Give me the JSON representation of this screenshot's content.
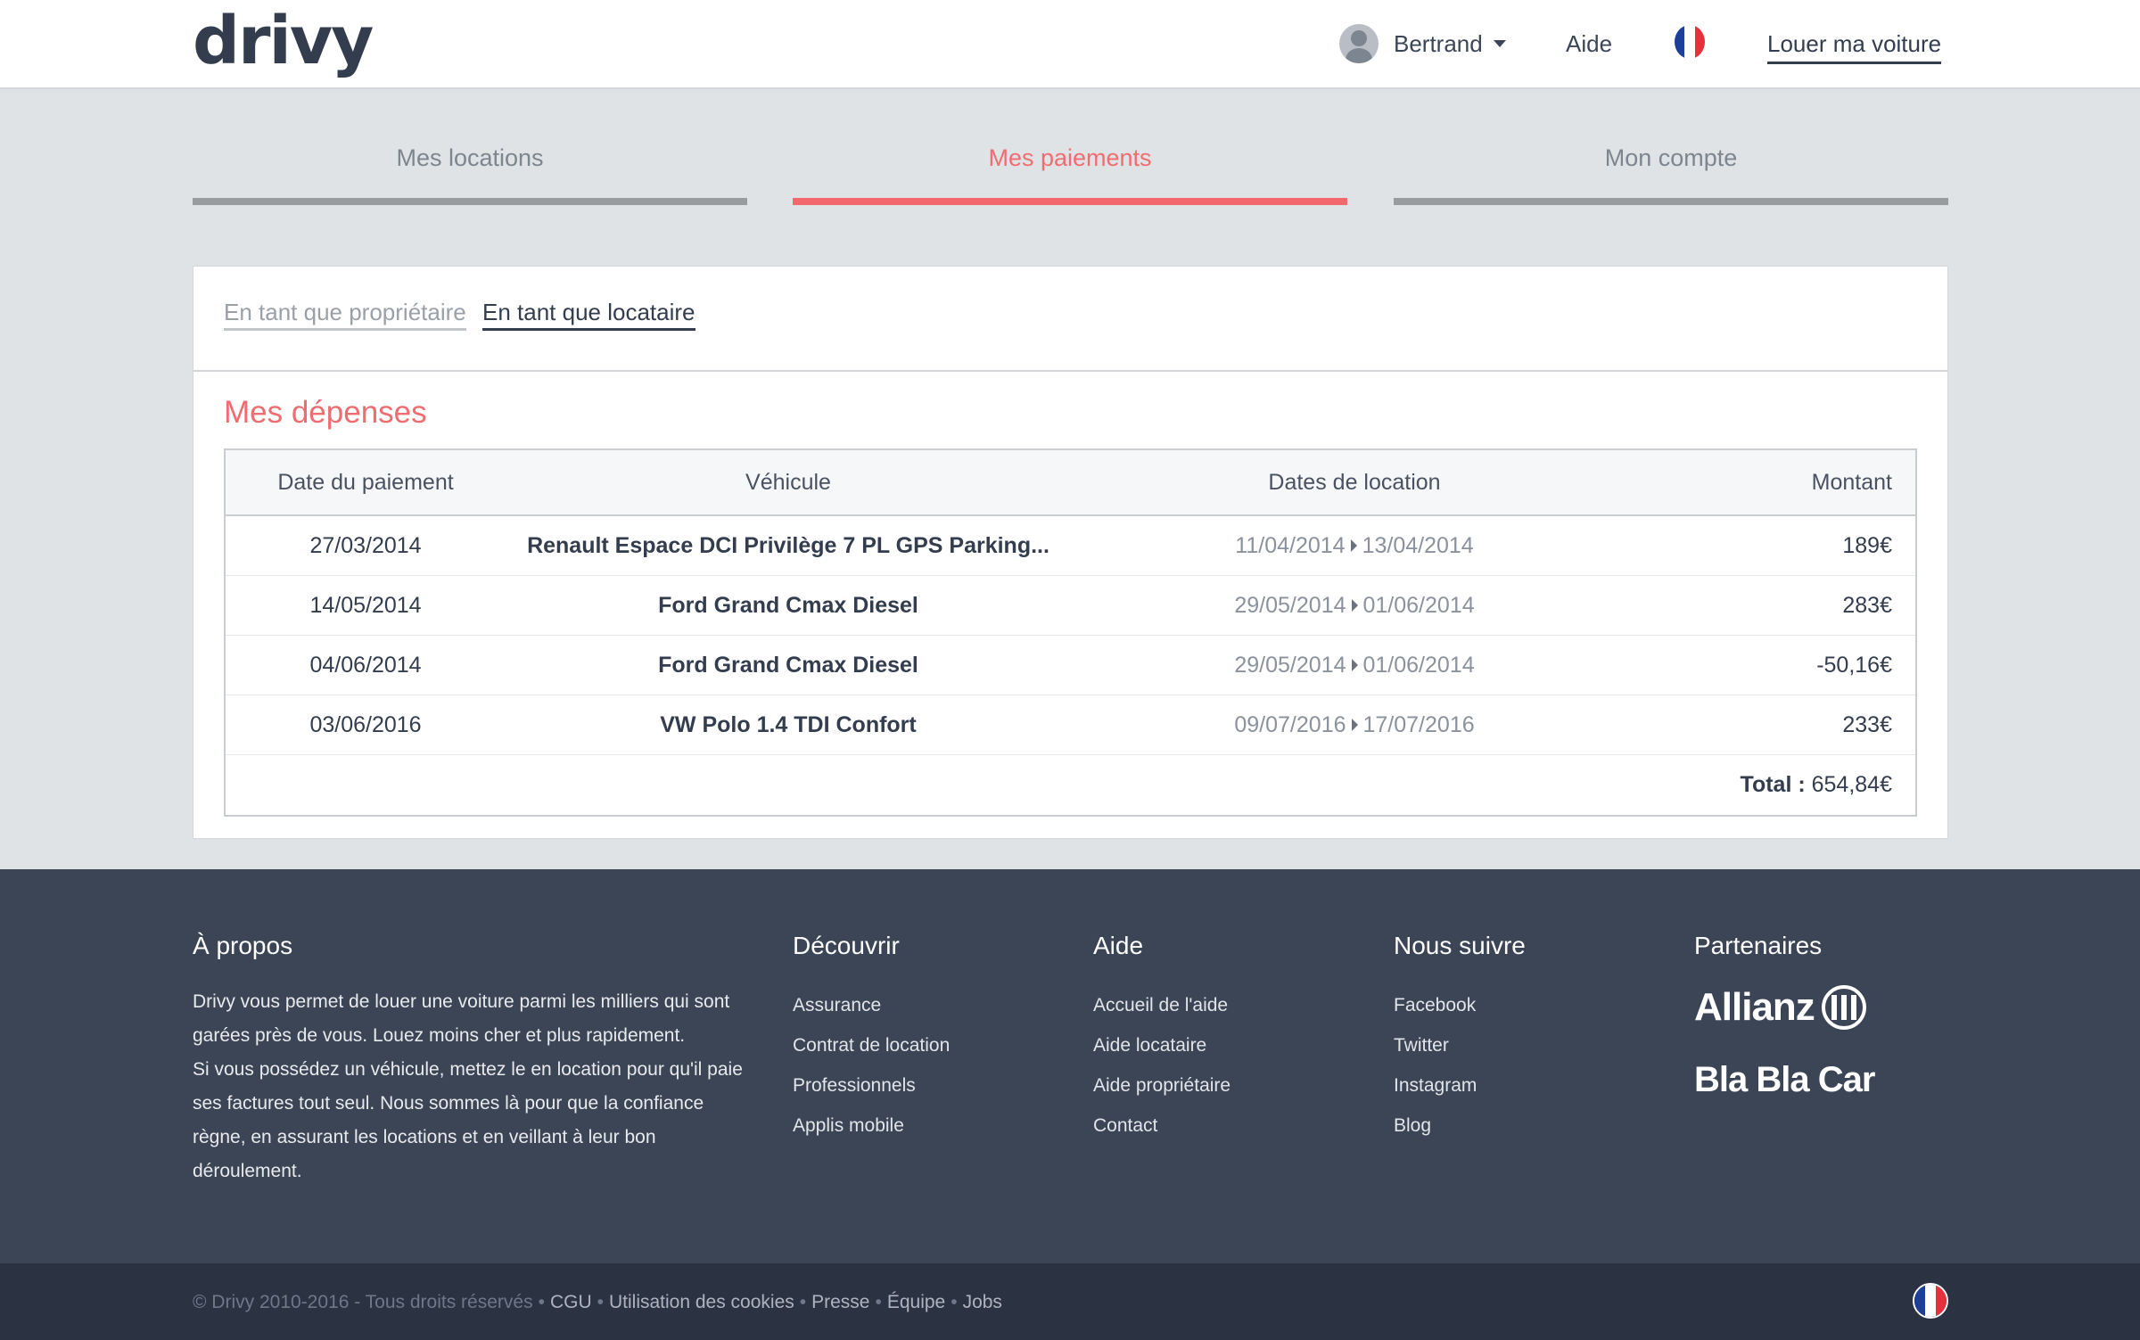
{
  "header": {
    "logo": "drivy",
    "user_name": "Bertrand",
    "help_label": "Aide",
    "rent_my_car_label": "Louer ma voiture"
  },
  "tabs": [
    {
      "label": "Mes locations",
      "active": false
    },
    {
      "label": "Mes paiements",
      "active": true
    },
    {
      "label": "Mon compte",
      "active": false
    }
  ],
  "subtabs": {
    "owner": "En tant que propriétaire",
    "renter": "En tant que locataire"
  },
  "section_title": "Mes dépenses",
  "table": {
    "headers": [
      "Date du paiement",
      "Véhicule",
      "Dates de location",
      "Montant"
    ],
    "rows": [
      {
        "date": "27/03/2014",
        "vehicle": "Renault Espace DCI Privilège 7 PL GPS Parking...",
        "start": "11/04/2014",
        "end": "13/04/2014",
        "amount": "189€"
      },
      {
        "date": "14/05/2014",
        "vehicle": "Ford Grand Cmax Diesel",
        "start": "29/05/2014",
        "end": "01/06/2014",
        "amount": "283€"
      },
      {
        "date": "04/06/2014",
        "vehicle": "Ford Grand Cmax Diesel",
        "start": "29/05/2014",
        "end": "01/06/2014",
        "amount": "-50,16€"
      },
      {
        "date": "03/06/2016",
        "vehicle": "VW Polo 1.4 TDI Confort",
        "start": "09/07/2016",
        "end": "17/07/2016",
        "amount": "233€"
      }
    ],
    "total_label": "Total :",
    "total_value": "654,84€"
  },
  "footer": {
    "about": {
      "title": "À propos",
      "text1": "Drivy vous permet de louer une voiture parmi les milliers qui sont garées près de vous. Louez moins cher et plus rapidement.",
      "text2": "Si vous possédez un véhicule, mettez le en location pour qu'il paie ses factures tout seul. Nous sommes là pour que la confiance règne, en assurant les locations et en veillant à leur bon déroulement."
    },
    "discover": {
      "title": "Découvrir",
      "links": [
        "Assurance",
        "Contrat de location",
        "Professionnels",
        "Applis mobile"
      ]
    },
    "help": {
      "title": "Aide",
      "links": [
        "Accueil de l'aide",
        "Aide locataire",
        "Aide propriétaire",
        "Contact"
      ]
    },
    "follow": {
      "title": "Nous suivre",
      "links": [
        "Facebook",
        "Twitter",
        "Instagram",
        "Blog"
      ]
    },
    "partners": {
      "title": "Partenaires",
      "allianz": "Allianz",
      "blablacar": "Bla Bla Car"
    }
  },
  "bottom": {
    "copyright": "© Drivy 2010-2016 - Tous droits réservés",
    "links": [
      "CGU",
      "Utilisation des cookies",
      "Presse",
      "Équipe",
      "Jobs"
    ]
  },
  "colors": {
    "accent": "#f2686d",
    "footer_bg": "#3b4556",
    "bottom_bg": "#2b3241",
    "page_bg": "#e0e3e6"
  }
}
